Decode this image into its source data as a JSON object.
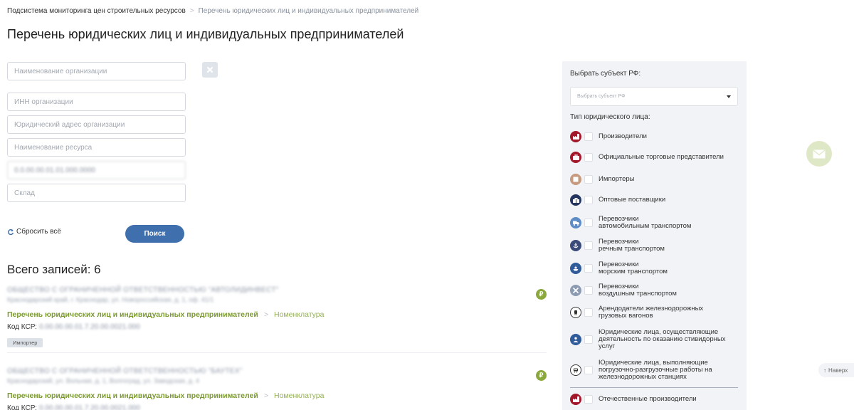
{
  "breadcrumb": {
    "root": "Подсистема мониторинга цен строительных ресурсов",
    "current": "Перечень юридических лиц и индивидуальных предпринимателей"
  },
  "page_title": "Перечень юридических лиц и индивидуальных предпринимателей",
  "search_form": {
    "org_name_placeholder": "Наименование организации",
    "inn_placeholder": "ИНН организации",
    "address_placeholder": "Юридический адрес организации",
    "resource_placeholder": "Наименование ресурса",
    "code_value": "0.0.00.00.01.01.000.0000",
    "warehouse_placeholder": "Склад",
    "reset_label": "Сбросить всё",
    "search_label": "Поиск"
  },
  "records_total": "Всего записей: 6",
  "records": [
    {
      "name": "ОБЩЕСТВО С ОГРАНИЧЕННОЙ ОТВЕТСТВЕННОСТЬЮ \"АВТОЛИДИНВЕСТ\"",
      "address": "Краснодарский край, г. Краснодар, ул. Новороссийская, д. 1, оф. 41/1",
      "link_main": "Перечень юридических лиц и индивидуальных предпринимателей",
      "link_sub": "Номенклатура",
      "code_label": "Код КСР:",
      "code_value": "0.00.00.00.01.7.20.00.0021.000",
      "tag": "Импортер",
      "badge_symbol": "₽"
    },
    {
      "name": "ОБЩЕСТВО С ОГРАНИЧЕННОЙ ОТВЕТСТВЕННОСТЬЮ \"БАУТЕХ\"",
      "address": "Краснодарский, ул. Вольная, д. 1, Волгоград, ул. Заводская, д. 4",
      "link_main": "Перечень юридических лиц и индивидуальных предпринимателей",
      "link_sub": "Номенклатура",
      "code_label": "Код КСР:",
      "code_value": "0.00.00.00.01.7.20.00.0021.000",
      "badge_symbol": "₽"
    }
  ],
  "filter_panel": {
    "region_label": "Выбрать субъект РФ:",
    "region_placeholder": "Выбрать субъект РФ",
    "type_label": "Тип юридического лица:",
    "types": [
      {
        "label": "Производители",
        "icon": "factory-icon",
        "color": "#a3172b"
      },
      {
        "label": "Официальные торговые представители",
        "icon": "briefcase-icon",
        "color": "#a3172b"
      },
      {
        "label": "Импортеры",
        "icon": "box-icon",
        "color": "#c59a7e"
      },
      {
        "label": "Оптовые поставщики",
        "icon": "boxes-icon",
        "color": "#24365f"
      },
      {
        "label": "Перевозчики\nавтомобильным транспортом",
        "icon": "truck-icon",
        "color": "#5d8cc6"
      },
      {
        "label": "Перевозчики\nречным транспортом",
        "icon": "anchor-icon",
        "color": "#3a4b7a"
      },
      {
        "label": "Перевозчики\nморским транспортом",
        "icon": "ship-icon",
        "color": "#2f5b9b"
      },
      {
        "label": "Перевозчики\nвоздушным транспортом",
        "icon": "plane-icon",
        "color": "#8c9bb2"
      },
      {
        "label": "Арендодатели железнодорожных\nгрузовых вагонов",
        "icon": "railcar-icon",
        "color": "#ffffff"
      },
      {
        "label": "Юридические лица, осуществляющие\nдеятельность по оказанию стивидорных\nуслуг",
        "icon": "stevedore-icon",
        "color": "#2f5b9b"
      },
      {
        "label": "Юридические лица, выполняющие\nпогрузочно-разгрузочные работы на\nжелезнодорожных станциях",
        "icon": "train-icon",
        "color": "#ffffff"
      },
      {
        "label": "Отечественные производители",
        "icon": "flag-factory-icon",
        "color": "#a3172b"
      }
    ]
  },
  "to_top_label": "Наверх",
  "colors": {
    "primary_button": "#3f6fad",
    "link_green": "#7b9a2f",
    "panel_bg": "#f2f3f6"
  }
}
